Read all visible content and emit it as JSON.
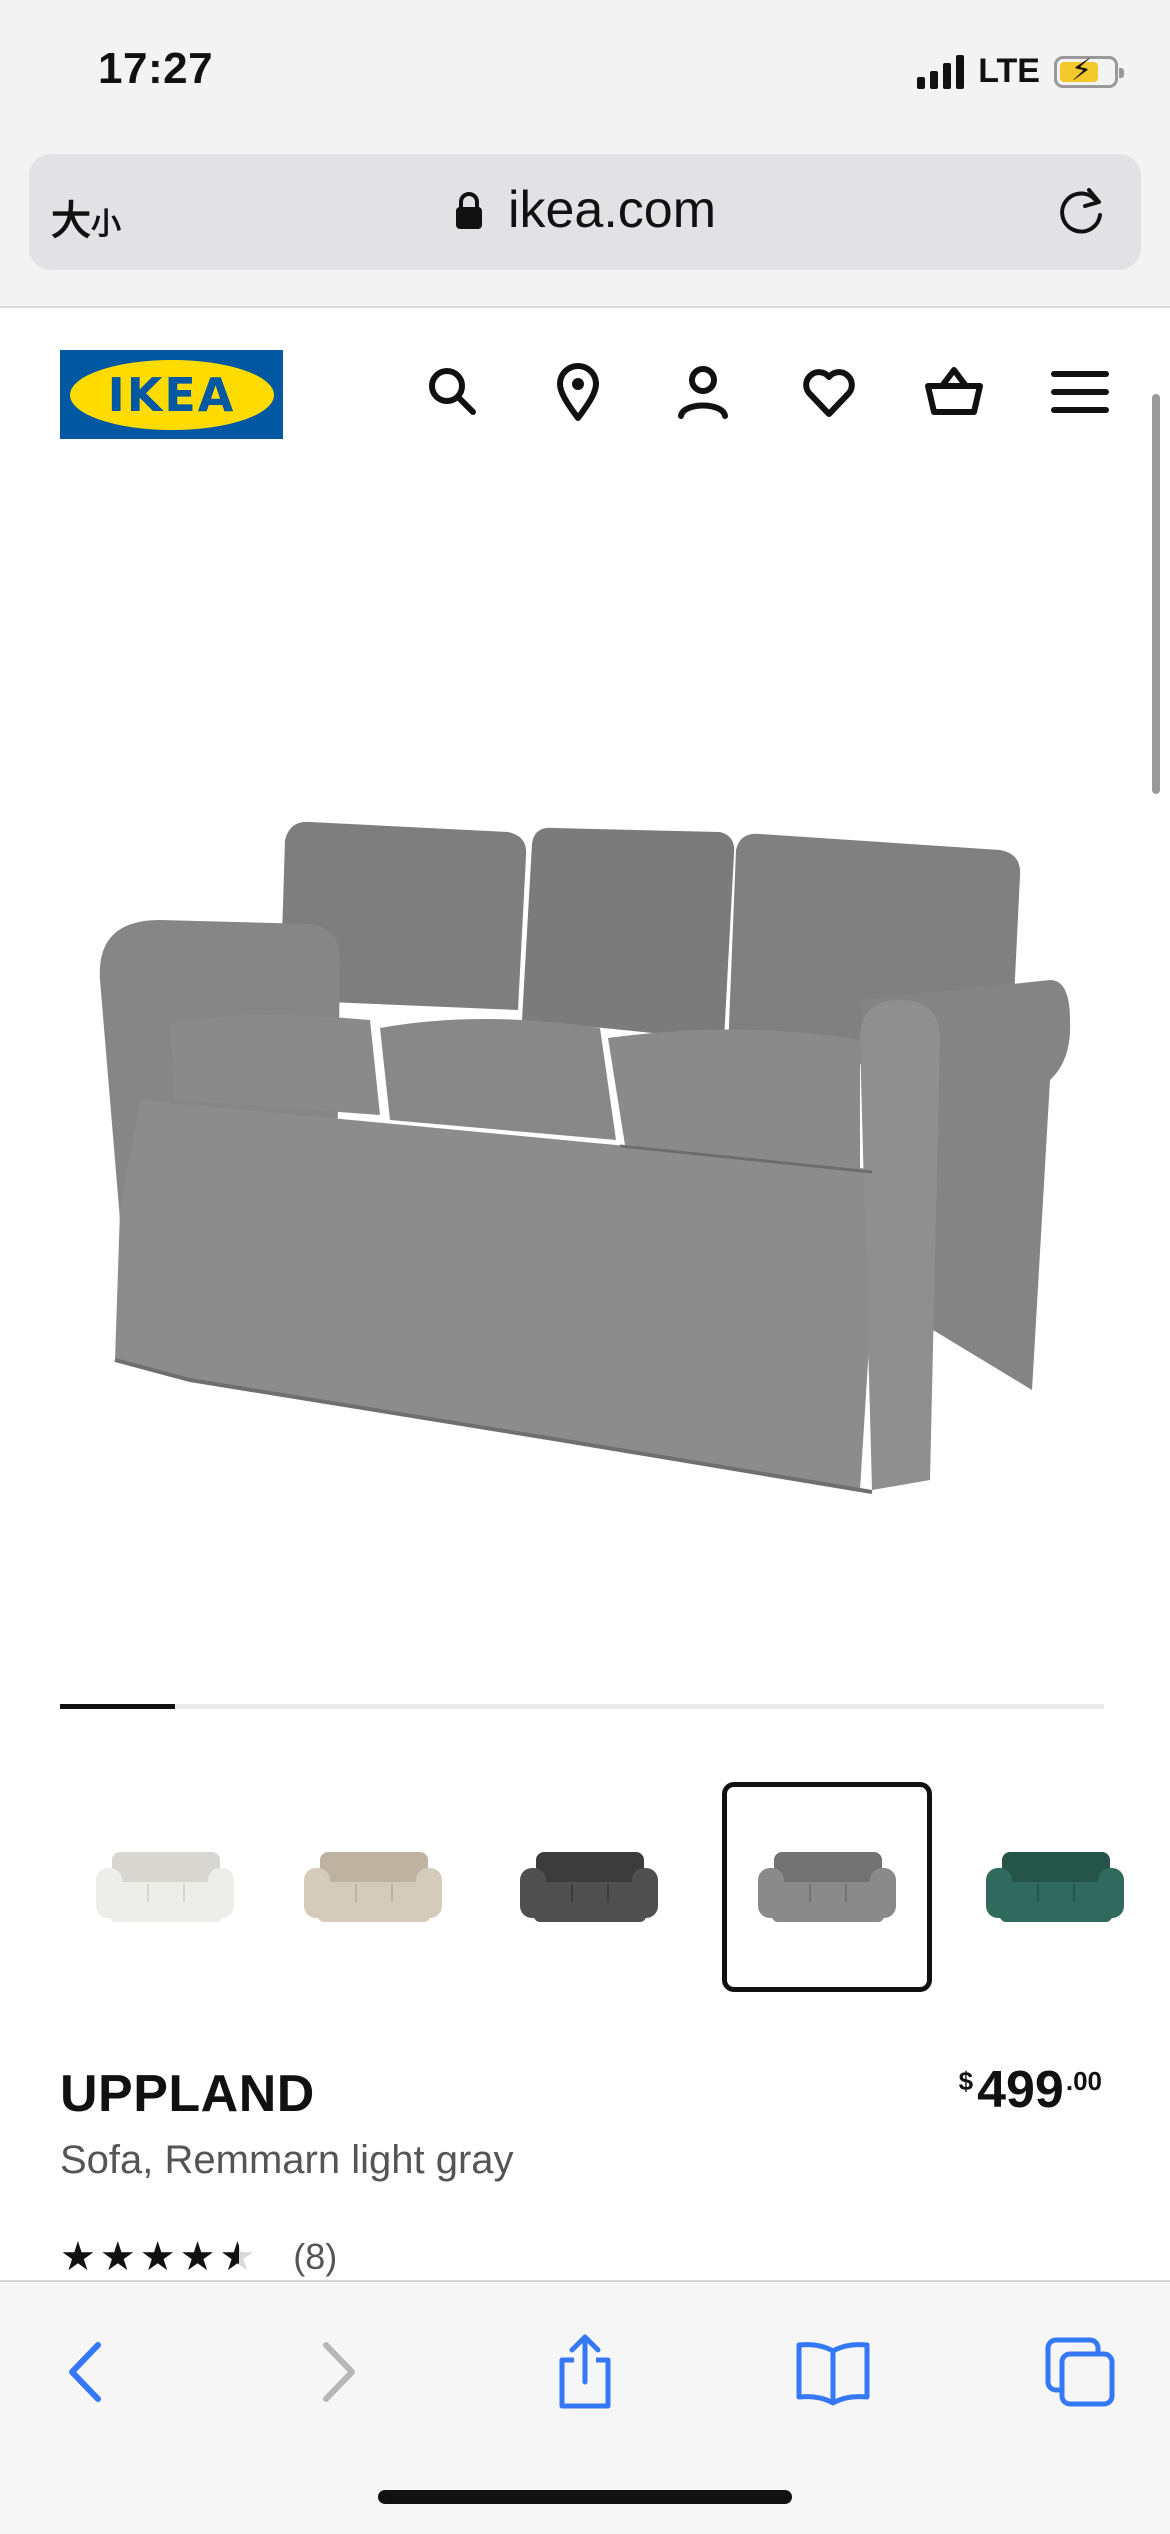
{
  "status_bar": {
    "time": "17:27",
    "network": "LTE"
  },
  "browser": {
    "text_size_label": "大",
    "text_size_small": "小",
    "url": "ikea.com"
  },
  "header": {
    "logo_text": "IKEA",
    "brand_colors": {
      "blue": "#0058a3",
      "yellow": "#ffdb00"
    },
    "icons": [
      "search-icon",
      "location-pin-icon",
      "account-icon",
      "heart-icon",
      "basket-icon",
      "hamburger-menu-icon"
    ]
  },
  "gallery": {
    "progress": 0.11
  },
  "color_swatches": [
    {
      "name": "white",
      "color": "#ededea",
      "dark": "#d7d6d1"
    },
    {
      "name": "beige",
      "color": "#d5cbbb",
      "dark": "#beb3a1"
    },
    {
      "name": "dark gray",
      "color": "#505050",
      "dark": "#3c3c3c"
    },
    {
      "name": "light gray",
      "color": "#8a8a8a",
      "dark": "#727272",
      "selected": true
    },
    {
      "name": "green",
      "color": "#2f6a5c",
      "dark": "#245548"
    }
  ],
  "product": {
    "name": "UPPLAND",
    "description": "Sofa, Remmarn light gray",
    "price": {
      "currency": "$",
      "amount": "499",
      "decimals": ".00"
    },
    "rating": {
      "value": 4.5,
      "max": 5,
      "count_text": "(8)"
    }
  },
  "toolbar": {
    "icons": [
      "back-chevron-icon",
      "forward-chevron-icon",
      "share-icon",
      "bookmarks-icon",
      "tabs-icon"
    ],
    "accent": "#3478f6"
  }
}
